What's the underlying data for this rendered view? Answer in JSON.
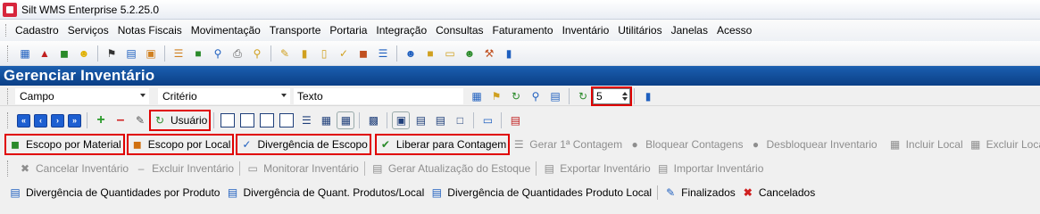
{
  "window": {
    "title": "Silt WMS Enterprise 5.2.25.0"
  },
  "menu": [
    "Cadastro",
    "Serviços",
    "Notas Fiscais",
    "Movimentação",
    "Transporte",
    "Portaria",
    "Integração",
    "Consultas",
    "Faturamento",
    "Inventário",
    "Utilitários",
    "Janelas",
    "Acesso"
  ],
  "page": {
    "title": "Gerenciar Inventário"
  },
  "filter": {
    "field_label": "Campo",
    "criteria_label": "Critério",
    "text_label": "Texto",
    "spin_value": "5"
  },
  "toolbar2": {
    "user_label": "Usuário"
  },
  "actions_row1": [
    {
      "label": "Escopo por Material",
      "icon": "green-box-icon"
    },
    {
      "label": "Escopo por Local",
      "icon": "orange-box-icon"
    },
    {
      "label": "Divergência de Escopo",
      "icon": "clipboard-check-icon"
    },
    {
      "label": "Liberar para Contagem",
      "icon": "double-check-icon"
    },
    {
      "label": "Gerar 1ª Contagem",
      "icon": "list-icon"
    },
    {
      "label": "Bloquear Contagens",
      "icon": "block-icon"
    },
    {
      "label": "Desbloquear Inventario",
      "icon": "unblock-icon"
    },
    {
      "label": "Incluir Local",
      "icon": "add-location-icon"
    },
    {
      "label": "Excluir Local",
      "icon": "remove-location-icon"
    }
  ],
  "actions_row2": [
    {
      "label": "Cancelar Inventário",
      "icon": "cancel-x-icon"
    },
    {
      "label": "Excluir Inventário",
      "icon": "minus-icon"
    },
    {
      "label": "Monitorar Inventário",
      "icon": "monitor-icon"
    },
    {
      "label": "Gerar Atualização do Estoque",
      "icon": "update-stock-icon"
    },
    {
      "label": "Exportar Inventário",
      "icon": "export-icon"
    },
    {
      "label": "Importar Inventário",
      "icon": "import-icon"
    }
  ],
  "reports_row": [
    {
      "label": "Divergência de Quantidades por Produto",
      "icon": "report-icon"
    },
    {
      "label": "Divergência de Quant. Produtos/Local",
      "icon": "chart-report-icon"
    },
    {
      "label": "Divergência de Quantidades Produto Local",
      "icon": "report-icon"
    },
    {
      "label": "Finalizados",
      "icon": "pencil-icon"
    },
    {
      "label": "Cancelados",
      "icon": "red-x-icon"
    }
  ],
  "colors": {
    "header_bg": "#0b3f86",
    "highlight_outline": "#e00000",
    "disabled_text": "#8e8e8e"
  }
}
